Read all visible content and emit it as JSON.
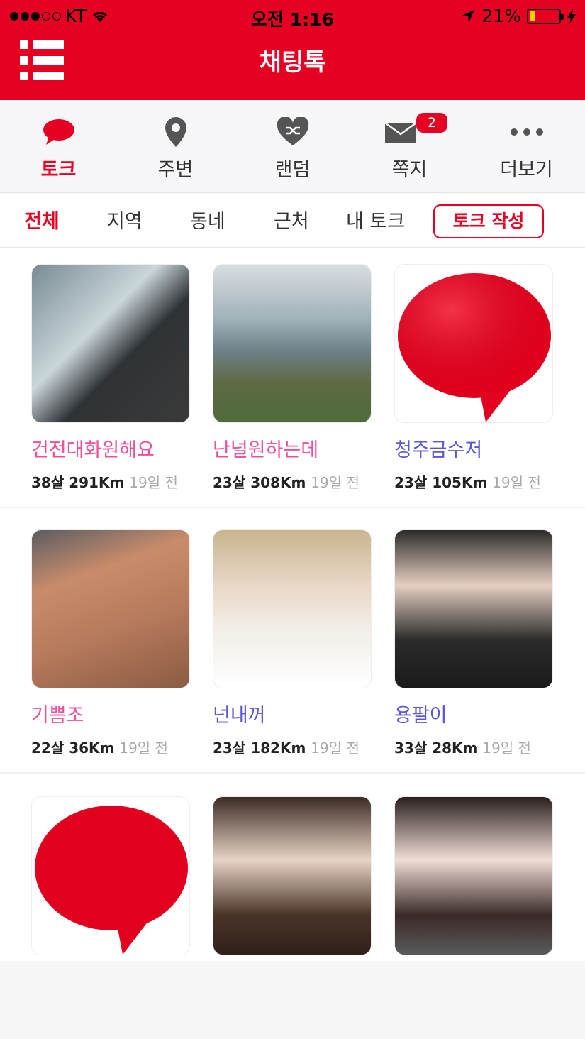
{
  "status_bar": {
    "carrier": "KT",
    "time": "오전 1:16",
    "battery": "21%",
    "battery_level": 0.21
  },
  "app_bar": {
    "title": "채팅톡",
    "menu_icon": "hamburger-menu-icon"
  },
  "main_tabs": [
    {
      "label": "토크",
      "icon": "speech-bubble-icon",
      "active": true
    },
    {
      "label": "주변",
      "icon": "location-pin-icon",
      "active": false
    },
    {
      "label": "랜덤",
      "icon": "shuffle-heart-icon",
      "active": false
    },
    {
      "label": "쪽지",
      "icon": "envelope-icon",
      "active": false,
      "badge": "2"
    },
    {
      "label": "더보기",
      "icon": "more-dots-icon",
      "active": false
    }
  ],
  "sub_tabs": [
    {
      "label": "전체",
      "active": true
    },
    {
      "label": "지역",
      "active": false
    },
    {
      "label": "동네",
      "active": false
    },
    {
      "label": "근처",
      "active": false
    },
    {
      "label": "내 토크",
      "active": false
    }
  ],
  "write_button": "토크 작성",
  "logo_text": "채팅톡",
  "colors": {
    "brand_red": "#e60022",
    "female_name": "#ee4f9b",
    "male_name": "#5c57d6",
    "meta_gray": "#aaaaaa"
  },
  "users": [
    {
      "name": "건전대화원해요",
      "gender": "female",
      "age": "38살",
      "distance": "291Km",
      "ago": "19일 전",
      "photo": "car-driver-photo"
    },
    {
      "name": "난널원하는데",
      "gender": "female",
      "age": "23살",
      "distance": "308Km",
      "ago": "19일 전",
      "photo": "seaside-photo"
    },
    {
      "name": "청주금수저",
      "gender": "male",
      "age": "23살",
      "distance": "105Km",
      "ago": "19일 전",
      "photo": "default-logo"
    },
    {
      "name": "기쁨조",
      "gender": "female",
      "age": "22살",
      "distance": "36Km",
      "ago": "19일 전",
      "photo": "tattoo-photo"
    },
    {
      "name": "넌내꺼",
      "gender": "male",
      "age": "23살",
      "distance": "182Km",
      "ago": "19일 전",
      "photo": "selfie-photo"
    },
    {
      "name": "용팔이",
      "gender": "male",
      "age": "33살",
      "distance": "28Km",
      "ago": "19일 전",
      "photo": "selfie-photo"
    },
    {
      "name": "",
      "gender": "",
      "age": "",
      "distance": "",
      "ago": "",
      "photo": "default-logo"
    },
    {
      "name": "",
      "gender": "",
      "age": "",
      "distance": "",
      "ago": "",
      "photo": "selfie-photo"
    },
    {
      "name": "",
      "gender": "",
      "age": "",
      "distance": "",
      "ago": "",
      "photo": "selfie-photo"
    }
  ]
}
